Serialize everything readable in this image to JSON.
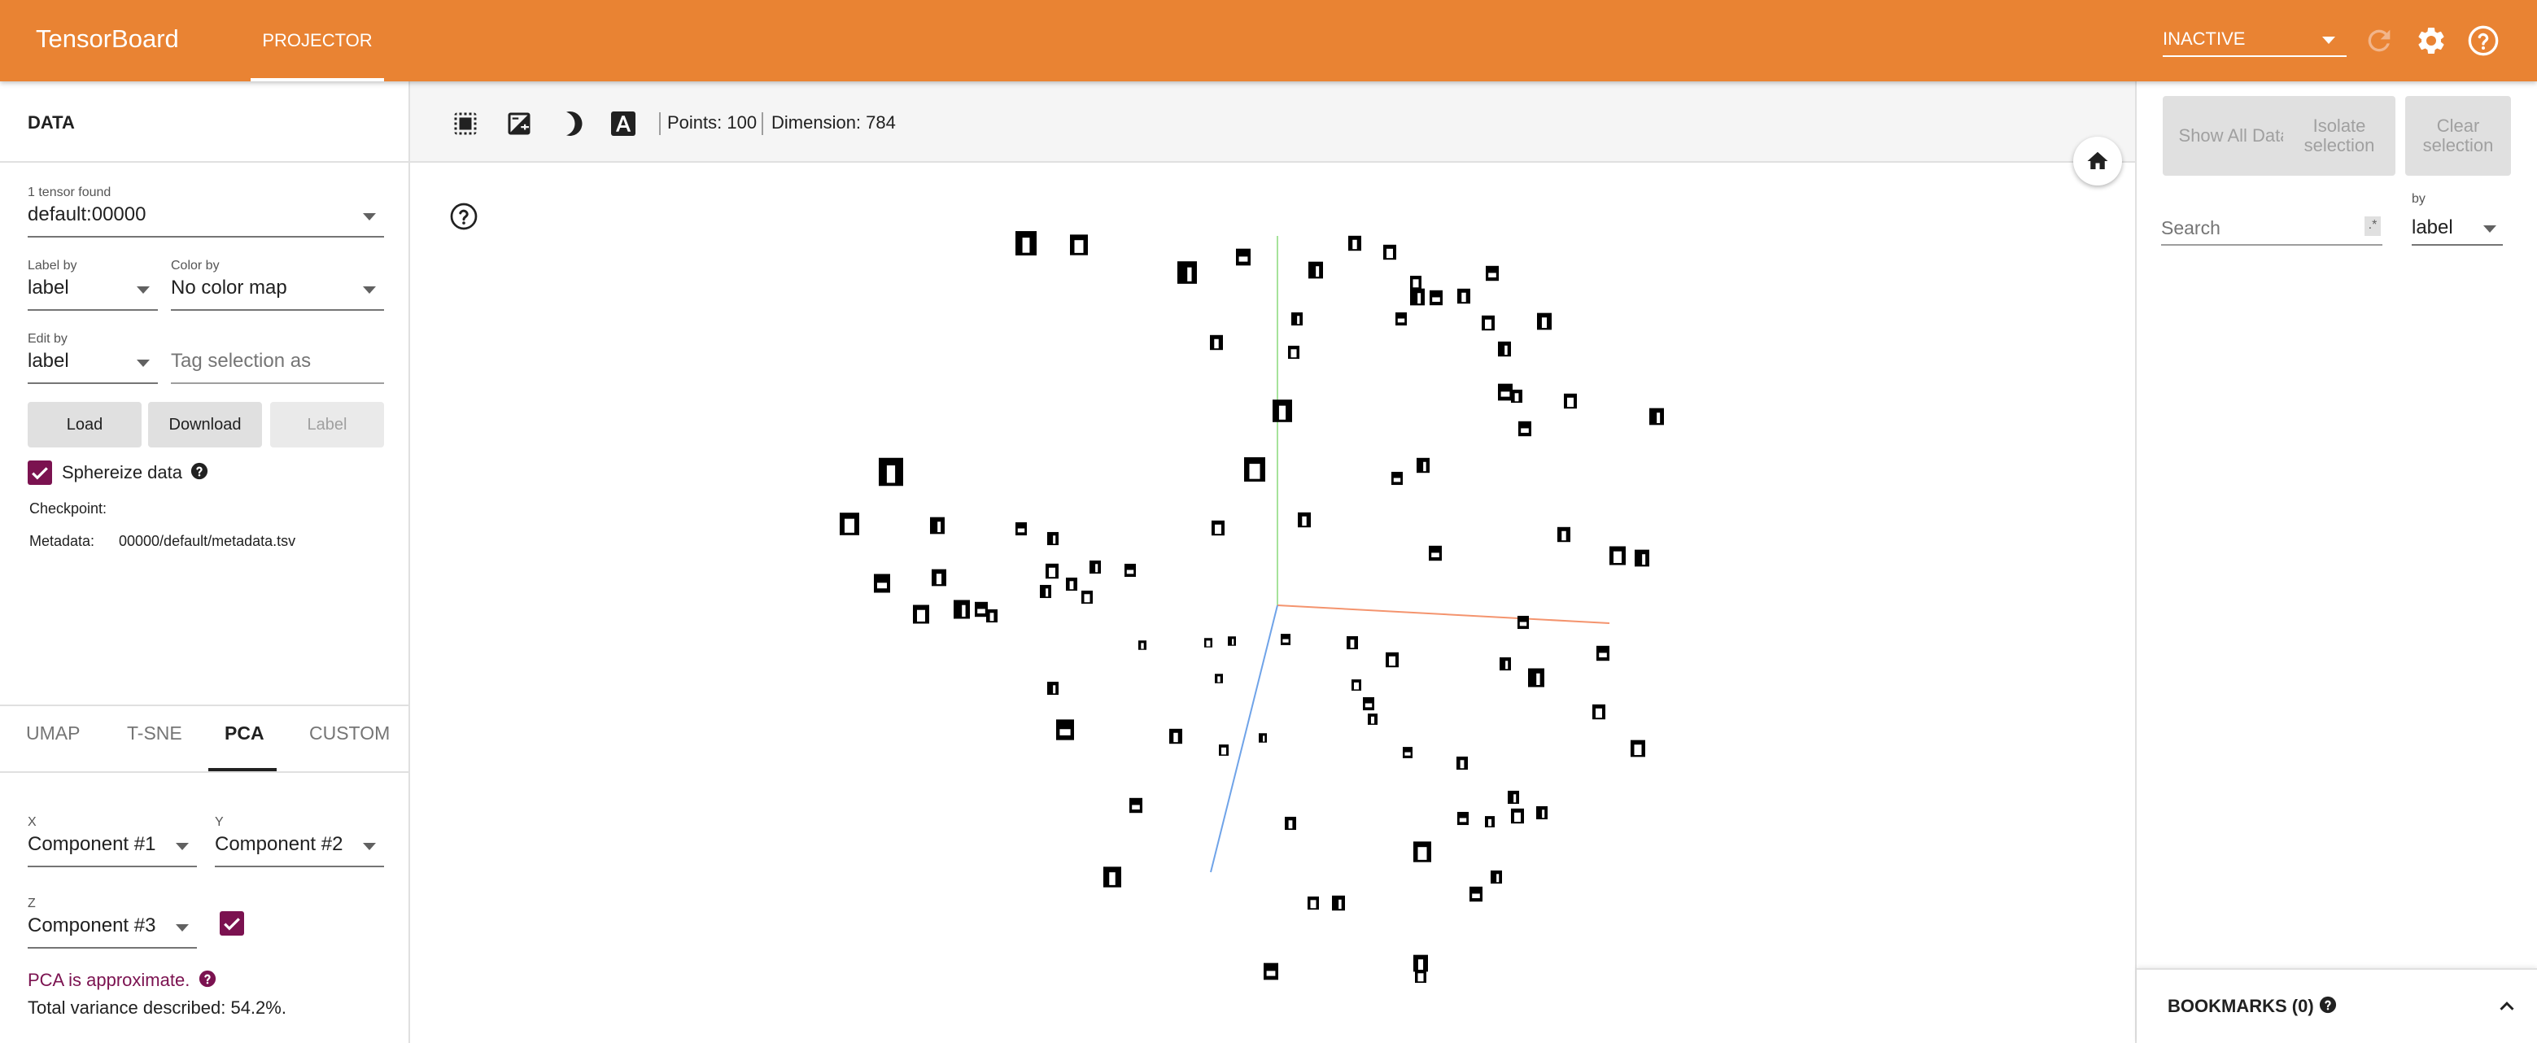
{
  "topbar": {
    "brand": "TensorBoard",
    "tab": "PROJECTOR",
    "status": "INACTIVE",
    "icons": [
      "refresh-icon",
      "gear-icon",
      "help-icon"
    ],
    "accent_color": "#e98333"
  },
  "left": {
    "section_title": "DATA",
    "tensor": {
      "label": "1 tensor found",
      "value": "default:00000"
    },
    "label_by": {
      "label": "Label by",
      "value": "label"
    },
    "color_by": {
      "label": "Color by",
      "value": "No color map"
    },
    "edit_by": {
      "label": "Edit by",
      "value": "label"
    },
    "tag_placeholder": "Tag selection as",
    "buttons": {
      "load": "Load",
      "download": "Download",
      "label": "Label"
    },
    "sphereize": {
      "label": "Sphereize data",
      "checked": true
    },
    "checkpoint_label": "Checkpoint:",
    "metadata_label": "Metadata:",
    "metadata_value": "00000/default/metadata.tsv",
    "projection_tabs": [
      "UMAP",
      "T-SNE",
      "PCA",
      "CUSTOM"
    ],
    "active_tab": "PCA",
    "pca": {
      "x_label": "X",
      "x_value": "Component #1",
      "y_label": "Y",
      "y_value": "Component #2",
      "z_label": "Z",
      "z_value": "Component #3",
      "z_enabled": true,
      "note": "PCA is approximate.",
      "variance": "Total variance described: 54.2%."
    },
    "checkbox_color": "#7b1250"
  },
  "toolbar": {
    "points": "Points: 100",
    "dimension": "Dimension: 784",
    "icons": [
      "select-rectangle-icon",
      "night-mode-icon",
      "brightness-icon",
      "labels-icon"
    ]
  },
  "right": {
    "show_all": "Show All Data",
    "isolate": "Isolate selection",
    "clear": "Clear selection",
    "search_placeholder": "Search",
    "regex": ".*",
    "by_label": "by",
    "by_value": "label",
    "bookmarks": "BOOKMARKS (0)"
  },
  "scene": {
    "axis_colors": {
      "x": "#f4946e",
      "y": "#a6e39b",
      "z": "#6fa3e8"
    },
    "point_count": 100,
    "sprite_color": "#000000"
  }
}
